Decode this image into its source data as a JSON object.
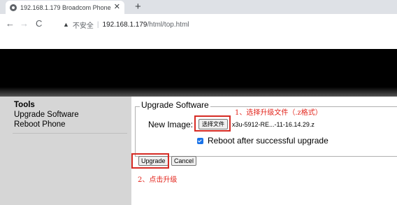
{
  "browser": {
    "tab_title": "192.168.1.179 Broadcom Phone",
    "tab_close": "✕",
    "new_tab": "+",
    "nav": {
      "back": "←",
      "forward": "→",
      "reload": "C"
    },
    "security_icon": "▲",
    "security_label": "不安全",
    "url_host": "192.168.1.179",
    "url_path": "/html/top.html"
  },
  "sidebar": {
    "title": "Tools",
    "items": [
      {
        "label": "Upgrade Software"
      },
      {
        "label": "Reboot Phone"
      }
    ]
  },
  "form": {
    "legend": "Upgrade Software",
    "new_image_label": "New Image:",
    "file_button": "选择文件",
    "file_name": "x3u-5912-RE...-11-16.14.29.z",
    "reboot_checked": true,
    "reboot_label": "Reboot after successful upgrade",
    "upgrade_button": "Upgrade",
    "cancel_button": "Cancel"
  },
  "annotations": {
    "step1": "1、选择升级文件（.z格式）",
    "step2": "2、点击升级",
    "color": "#e3261d"
  }
}
